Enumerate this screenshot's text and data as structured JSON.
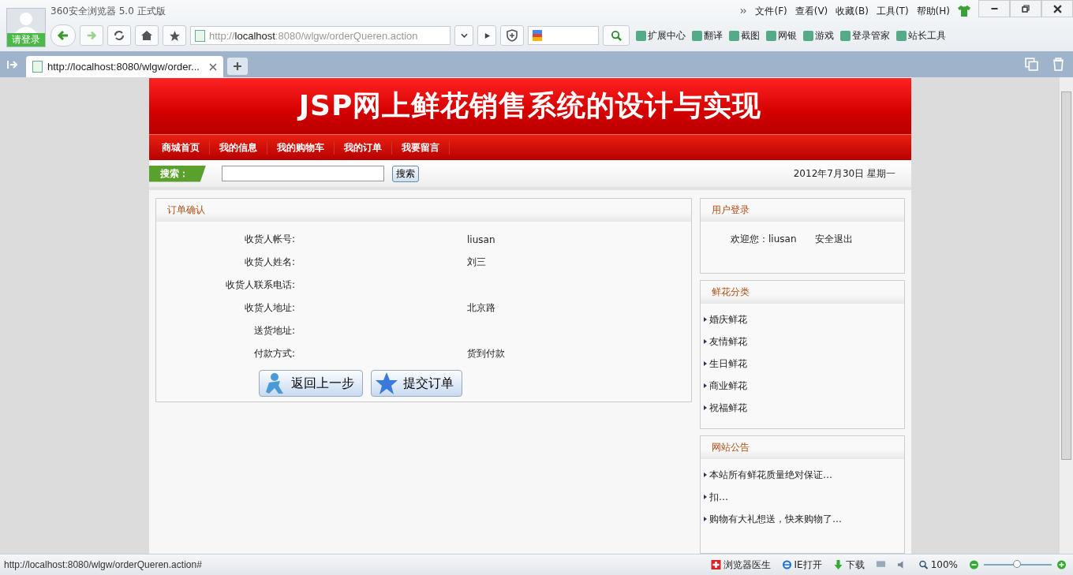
{
  "browser": {
    "title": "360安全浏览器 5.0 正式版",
    "login": "请登录",
    "url_scheme": "http://",
    "url_host": "localhost",
    "url_rest": ":8080/wlgw/orderQueren.action",
    "menus": [
      "文件(F)",
      "查看(V)",
      "收藏(B)",
      "工具(T)",
      "帮助(H)"
    ],
    "tools": [
      "扩展中心",
      "翻译",
      "截图",
      "网银",
      "游戏",
      "登录管家",
      "站长工具"
    ],
    "tab": {
      "title": "http://localhost:8080/wlgw/order...",
      "selected": true
    }
  },
  "site": {
    "title": "JSP网上鲜花销售系统的设计与实现",
    "nav": [
      {
        "label": "商城首页"
      },
      {
        "label": "我的信息"
      },
      {
        "label": "我的购物车"
      },
      {
        "label": "我的订单"
      },
      {
        "label": "我要留言"
      }
    ],
    "search": {
      "label": "搜索：",
      "button": "搜索"
    },
    "date": "2012年7月30日 星期一"
  },
  "order": {
    "title": "订单确认",
    "fields": [
      {
        "label": "收货人帐号:",
        "value": "liusan"
      },
      {
        "label": "收货人姓名:",
        "value": "刘三"
      },
      {
        "label": "收货人联系电话:"
      },
      {
        "label": "收货人地址:",
        "value": "北京路"
      },
      {
        "label": "送货地址:"
      },
      {
        "label": "付款方式:",
        "value": "货到付款"
      }
    ],
    "buttons": [
      {
        "label": "返回上一步",
        "kind": "back"
      },
      {
        "label": "提交订单",
        "kind": "submit"
      }
    ]
  },
  "login": {
    "title": "用户登录",
    "welcome": "欢迎您：liusan",
    "logout": "安全退出"
  },
  "categories": {
    "title": "鲜花分类",
    "items": [
      "婚庆鲜花",
      "友情鲜花",
      "生日鲜花",
      "商业鲜花",
      "祝福鲜花"
    ]
  },
  "notices": {
    "title": "网站公告",
    "items": [
      "本站所有鲜花质量绝对保证…",
      "扣…",
      "购物有大礼想送，快来购物了…"
    ]
  },
  "status": {
    "url": "http://localhost:8080/wlgw/orderQueren.action#",
    "doctor": "浏览器医生",
    "ie": "IE打开",
    "download": "下载",
    "zoom": "100%",
    "zoom_slider": {
      "level": 0.5
    }
  }
}
